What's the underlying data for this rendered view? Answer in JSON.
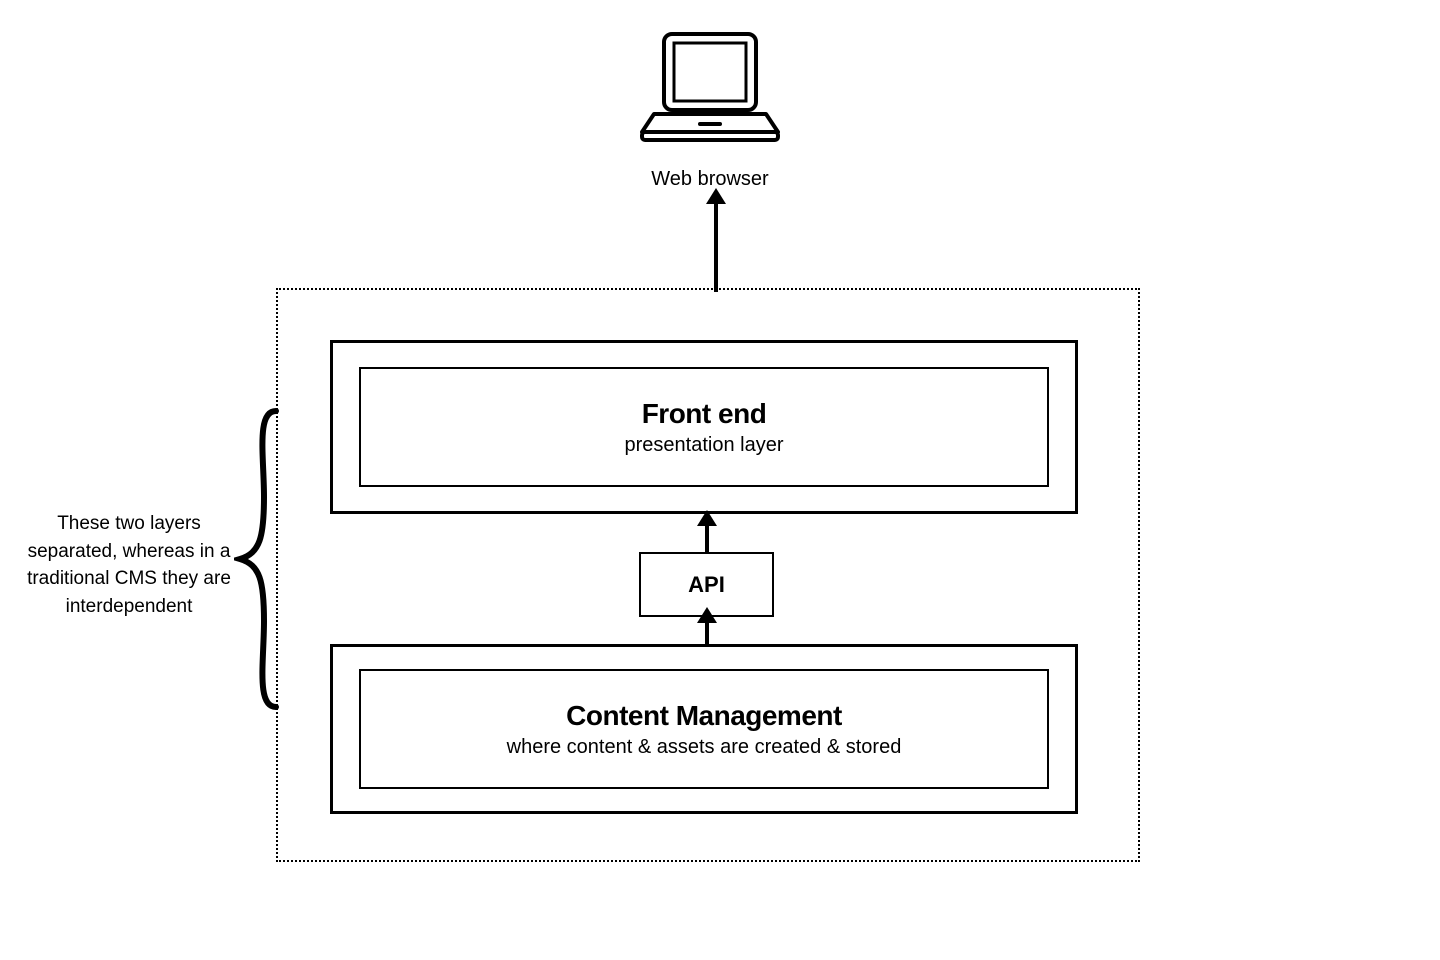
{
  "browser_label": "Web browser",
  "frontend": {
    "title": "Front end",
    "subtitle": "presentation layer"
  },
  "api": {
    "label": "API"
  },
  "backend": {
    "title": "Content Management",
    "subtitle": "where content & assets are created & stored"
  },
  "annotation": "These two layers separated, whereas in a traditional CMS they are interdependent"
}
